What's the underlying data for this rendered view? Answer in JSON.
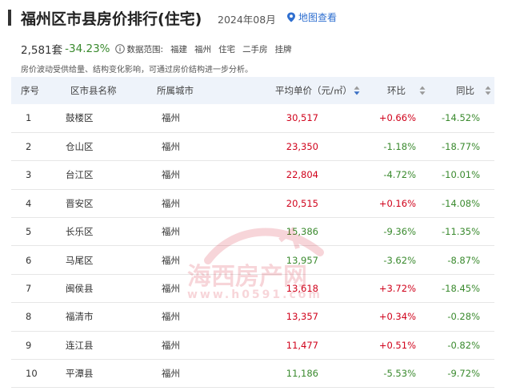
{
  "header": {
    "title": "福州区市县房价排行(住宅)",
    "date": "2024年08月",
    "map_link": "地图查看"
  },
  "stats": {
    "count": "2,581套",
    "change": "-34.23%",
    "scope_label": "数据范围:",
    "tags": [
      "福建",
      "福州",
      "住宅",
      "二手房",
      "挂牌"
    ]
  },
  "note": "房价波动受供给量、结构变化影响，可通过房价结构进一步分析。",
  "table": {
    "columns": [
      "序号",
      "区市县名称",
      "所属城市",
      "平均单价（元/㎡）",
      "环比",
      "同比"
    ],
    "rows": [
      {
        "rank": "1",
        "name": "鼓楼区",
        "city": "福州",
        "price": "30,517",
        "mom": "+0.66%",
        "yoy": "-14.52%"
      },
      {
        "rank": "2",
        "name": "仓山区",
        "city": "福州",
        "price": "23,350",
        "mom": "-1.18%",
        "yoy": "-18.77%"
      },
      {
        "rank": "3",
        "name": "台江区",
        "city": "福州",
        "price": "22,804",
        "mom": "-4.72%",
        "yoy": "-10.01%"
      },
      {
        "rank": "4",
        "name": "晋安区",
        "city": "福州",
        "price": "20,515",
        "mom": "+0.16%",
        "yoy": "-14.08%"
      },
      {
        "rank": "5",
        "name": "长乐区",
        "city": "福州",
        "price": "15,386",
        "mom": "-9.36%",
        "yoy": "-11.35%"
      },
      {
        "rank": "6",
        "name": "马尾区",
        "city": "福州",
        "price": "13,957",
        "mom": "-3.62%",
        "yoy": "-8.87%"
      },
      {
        "rank": "7",
        "name": "闽侯县",
        "city": "福州",
        "price": "13,618",
        "mom": "+3.72%",
        "yoy": "-18.45%"
      },
      {
        "rank": "8",
        "name": "福清市",
        "city": "福州",
        "price": "13,357",
        "mom": "+0.34%",
        "yoy": "-0.28%"
      },
      {
        "rank": "9",
        "name": "连江县",
        "city": "福州",
        "price": "11,477",
        "mom": "+0.51%",
        "yoy": "-0.82%"
      },
      {
        "rank": "10",
        "name": "平潭县",
        "city": "福州",
        "price": "11,186",
        "mom": "-5.53%",
        "yoy": "-9.72%"
      }
    ]
  },
  "watermark": {
    "text": "海西房产网",
    "url": "www.h0591.com"
  },
  "colors": {
    "up": "#d0021b",
    "down": "#3a8a2e",
    "header_bg": "#eef3fa",
    "link": "#2f6fd0"
  }
}
